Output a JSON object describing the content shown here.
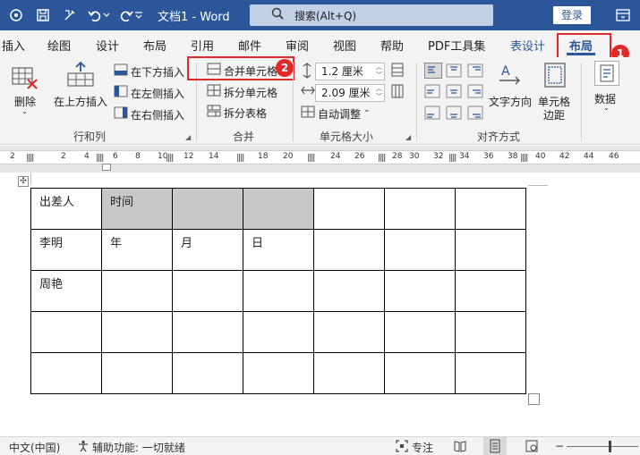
{
  "titlebar": {
    "title": "文档1  -  Word",
    "search_text": "搜索(Alt+Q)",
    "login_label": "登录"
  },
  "tabs": [
    "插入",
    "绘图",
    "设计",
    "布局",
    "引用",
    "邮件",
    "审阅",
    "视图",
    "帮助",
    "PDF工具集",
    "表设计",
    "布局"
  ],
  "badges": [
    "1",
    "2"
  ],
  "ribbon": {
    "delete_label": "删除",
    "insert_above_label": "在上方插入",
    "insert_below_label": "在下方插入",
    "insert_left_label": "在左侧插入",
    "insert_right_label": "在右侧插入",
    "rows_cols_group": "行和列",
    "merge_cells_label": "合并单元格",
    "split_cells_label": "拆分单元格",
    "split_table_label": "拆分表格",
    "merge_group": "合并",
    "height_value": "1.2 厘米",
    "width_value": "2.09 厘米",
    "autofit_label": "自动调整",
    "cell_size_group": "单元格大小",
    "text_direction_label": "文字方向",
    "cell_margins_label_1": "单元格",
    "cell_margins_label_2": "边距",
    "alignment_group": "对齐方式",
    "data_label": "数据"
  },
  "ruler_ticks": [
    "2",
    "2",
    "4",
    "6",
    "8",
    "10",
    "12",
    "14",
    "18",
    "20",
    "24",
    "26",
    "28",
    "30",
    "32",
    "34",
    "36",
    "38",
    "40",
    "42",
    "44",
    "46"
  ],
  "table": {
    "rows": [
      [
        "出差人",
        "时间",
        "",
        "",
        "",
        "",
        ""
      ],
      [
        "李明",
        "年",
        "月",
        "日",
        "",
        "",
        ""
      ],
      [
        "周艳",
        "",
        "",
        "",
        "",
        "",
        ""
      ],
      [
        "",
        "",
        "",
        "",
        "",
        "",
        ""
      ],
      [
        "",
        "",
        "",
        "",
        "",
        "",
        ""
      ]
    ]
  },
  "statusbar": {
    "language": "中文(中国)",
    "accessibility": "辅助功能: 一切就绪",
    "focus": "专注"
  },
  "colors": {
    "title_bar": "#2b579a",
    "highlight": "#e02a2a",
    "shaded_cell": "#c8c8c8"
  }
}
